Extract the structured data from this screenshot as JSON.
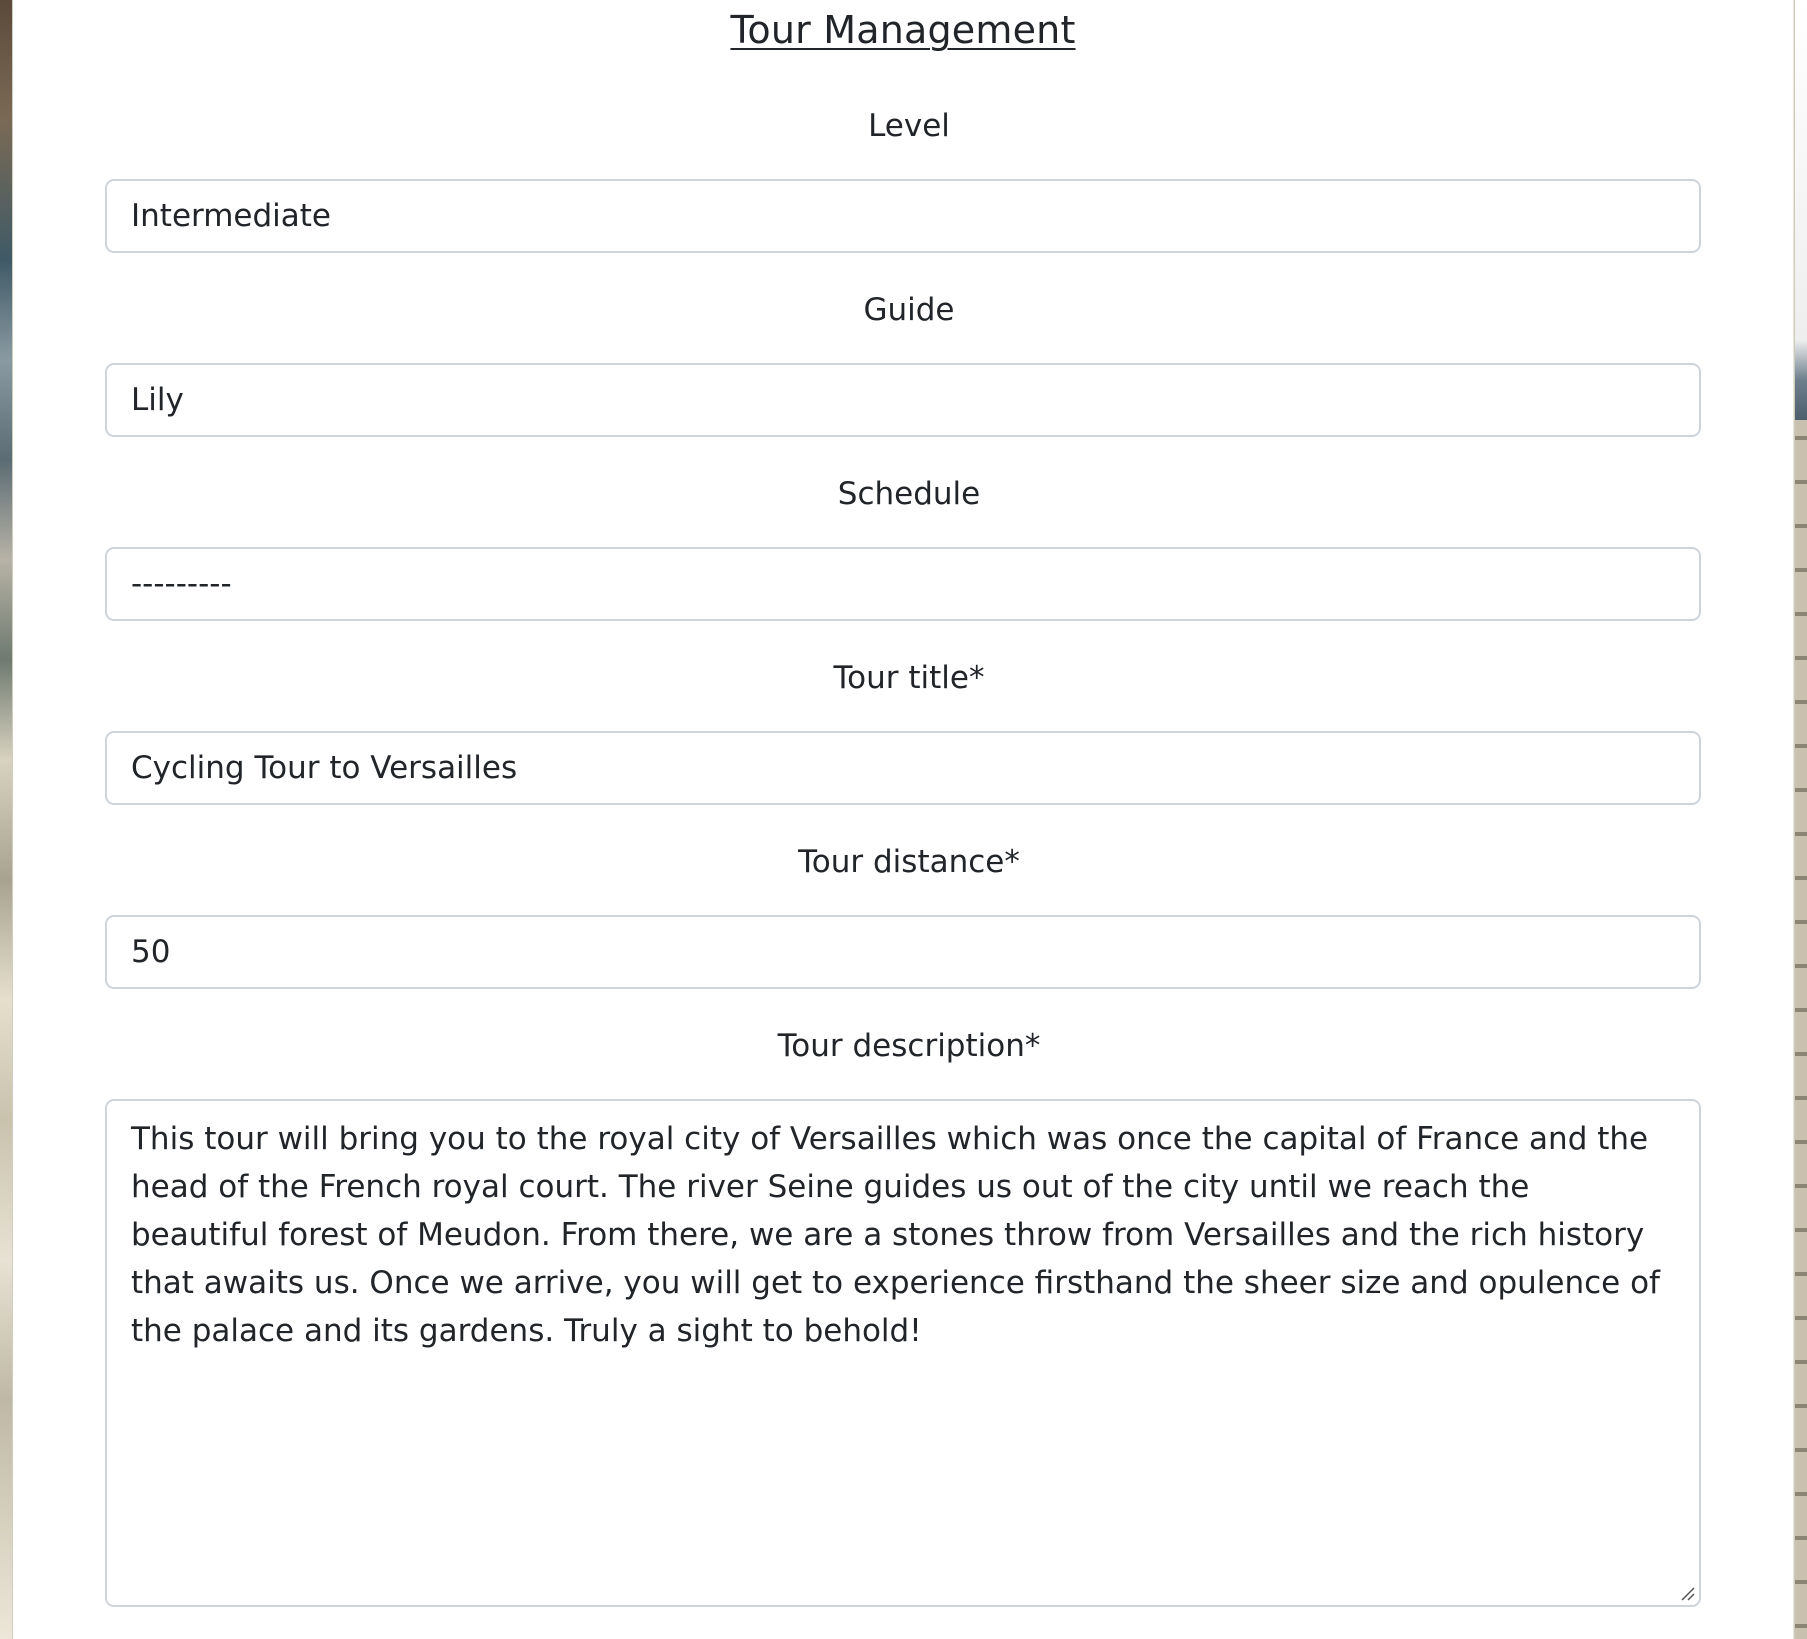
{
  "page": {
    "title": "Tour Management"
  },
  "form": {
    "level": {
      "label": "Level",
      "value": "Intermediate"
    },
    "guide": {
      "label": "Guide",
      "value": "Lily"
    },
    "schedule": {
      "label": "Schedule",
      "value": "---------"
    },
    "tour_title": {
      "label": "Tour title*",
      "value": "Cycling Tour to Versailles"
    },
    "tour_distance": {
      "label": "Tour distance*",
      "value": "50"
    },
    "tour_description": {
      "label": "Tour description*",
      "value": "This tour will bring you to the royal city of Versailles which was once the capital of France and the head of the French royal court. The river Seine guides us out of the city until we reach the beautiful forest of Meudon. From there, we are a stones throw from Versailles and the rich history that awaits us. Once we arrive, you will get to experience firsthand the sheer size and opulence of the palace and its gardens. Truly a sight to behold!"
    }
  },
  "colors": {
    "text": "#212529",
    "input_border": "#ced4da",
    "panel_background": "#ffffff"
  },
  "icons": {
    "textarea_resize": "resize-handle-icon"
  }
}
